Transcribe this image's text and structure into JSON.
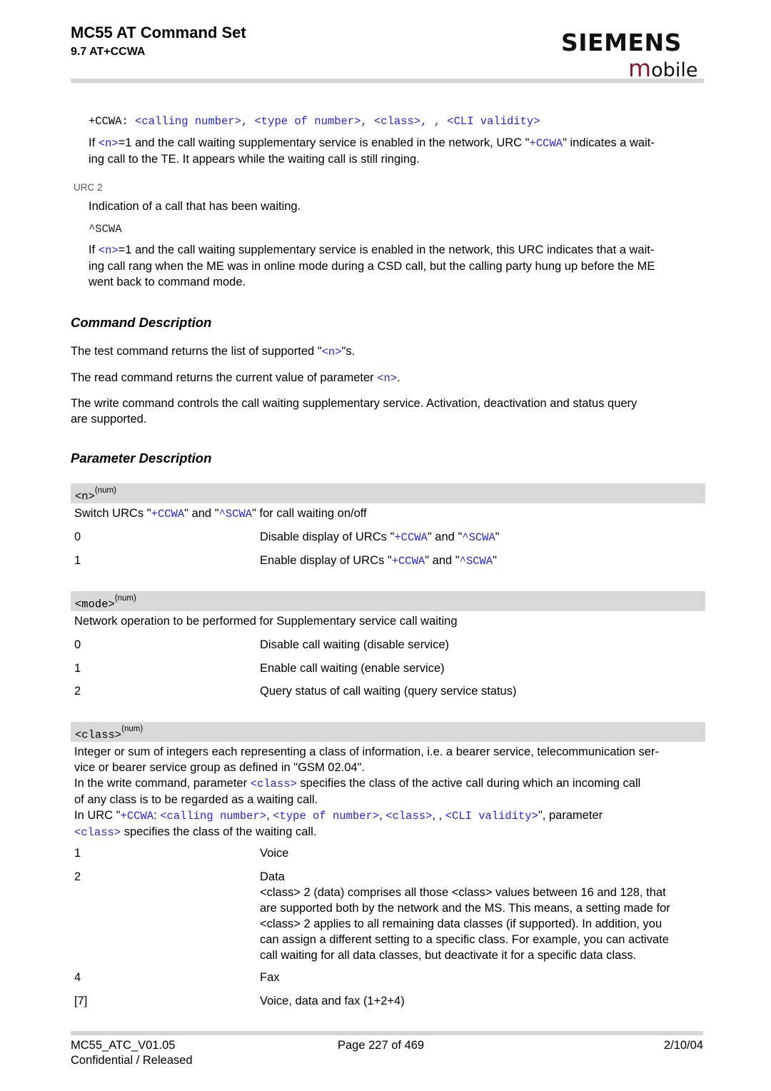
{
  "header": {
    "title": "MC55 AT Command Set",
    "section": "9.7 AT+CCWA",
    "logo_brand": "SIEMENS",
    "logo_sub_first": "m",
    "logo_sub_rest": "obile"
  },
  "urc1": {
    "syntax_prefix": "+CCWA: ",
    "syntax_params": "<calling number>, <type of number>, <class>, , <CLI validity>",
    "desc_part1": "If ",
    "desc_n": "<n>",
    "desc_part2": "=1 and the call waiting supplementary service is enabled in the network, URC \"",
    "desc_ccwa": "+CCWA",
    "desc_part3": "\" indicates a wait-",
    "desc_line2": "ing call to the TE. It appears while the waiting call is still ringing."
  },
  "urc2": {
    "label": "URC 2",
    "intro": "Indication of a call that has been waiting.",
    "syntax": "^SCWA",
    "desc_part1": "If ",
    "desc_n": "<n>",
    "desc_part2": "=1 and the call waiting supplementary service is enabled in the network, this URC indicates that a wait-",
    "desc_line2": "ing call rang when the ME was in online mode during a CSD call, but the calling party hung up before the ME",
    "desc_line3": "went back to command mode."
  },
  "command_description": {
    "heading": "Command Description",
    "test_part1": "The test command returns the list of supported \"",
    "test_n": "<n>",
    "test_part2": "\"s.",
    "read_part1": "The read command returns the current value of parameter ",
    "read_n": "<n>",
    "read_part2": ".",
    "write_line1": "The write command controls the call waiting supplementary service. Activation, deactivation and status query",
    "write_line2": "are supported."
  },
  "parameter_description": {
    "heading": "Parameter Description",
    "params": [
      {
        "name": "<n>",
        "type": "(num)",
        "desc_part1": "Switch URCs \"",
        "desc_ccwa": "+CCWA",
        "desc_part2": "\" and \"",
        "desc_scwa": "^SCWA",
        "desc_part3": "\" for call waiting on/off",
        "values": [
          {
            "value": "0",
            "desc_part1": "Disable display of URCs \"",
            "ccwa": "+CCWA",
            "desc_part2": "\" and \"",
            "scwa": "^SCWA",
            "desc_part3": "\""
          },
          {
            "value": "1",
            "desc_part1": "Enable display of URCs \"",
            "ccwa": "+CCWA",
            "desc_part2": "\" and \"",
            "scwa": "^SCWA",
            "desc_part3": "\""
          }
        ]
      },
      {
        "name": "<mode>",
        "type": "(num)",
        "desc": "Network operation to be performed for Supplementary service call waiting",
        "values": [
          {
            "value": "0",
            "desc": "Disable call waiting (disable service)"
          },
          {
            "value": "1",
            "desc": "Enable call waiting (enable service)"
          },
          {
            "value": "2",
            "desc": "Query status of call waiting (query service status)"
          }
        ]
      },
      {
        "name": "<class>",
        "type": "(num)",
        "desc_line1": "Integer or sum of integers each representing a class of information, i.e. a bearer service, telecommunication ser-",
        "desc_line2": "vice or bearer service group as defined in \"GSM 02.04\".",
        "desc_line3_part1": "In the write command, parameter ",
        "desc_line3_class": "<class>",
        "desc_line3_part2": " specifies the class of the active call during which an incoming call",
        "desc_line4": "of any class is to be regarded as a waiting call.",
        "desc_line5_part1": "In URC \"",
        "desc_line5_ccwa": "+CCWA",
        "desc_line5_colon": ": ",
        "desc_line5_calling": "<calling number>",
        "desc_line5_sep1": ", ",
        "desc_line5_type": "<type of number>",
        "desc_line5_sep2": ", ",
        "desc_line5_class": "<class>",
        "desc_line5_sep3": ", , ",
        "desc_line5_cli": "<CLI validity>",
        "desc_line5_part2": "\", parameter",
        "desc_line6_class": "<class>",
        "desc_line6_part2": " specifies the class of the waiting call.",
        "values": [
          {
            "value": "1",
            "desc": "Voice"
          },
          {
            "value": "2",
            "desc": "Data",
            "detail": [
              "<class> 2 (data) comprises all those <class> values between 16 and 128, that",
              "are supported both by the network and the MS. This means, a setting made for",
              "<class> 2 applies to all remaining data classes (if supported). In addition, you",
              "can assign a different setting to a specific class. For example, you can activate",
              "call waiting for all data classes, but deactivate it for a specific data class."
            ]
          },
          {
            "value": "4",
            "desc": "Fax"
          },
          {
            "value": "[7]",
            "desc": "Voice, data and fax (1+2+4)"
          }
        ]
      }
    ]
  },
  "footer": {
    "doc_id": "MC55_ATC_V01.05",
    "page": "Page 227 of 469",
    "date": "2/10/04",
    "classification": "Confidential / Released"
  },
  "colors": {
    "link": "#2525e0",
    "logo_accent": "#8b1a2b",
    "param_bar": "#d9d9d9",
    "rule": "#d6d6d6"
  }
}
